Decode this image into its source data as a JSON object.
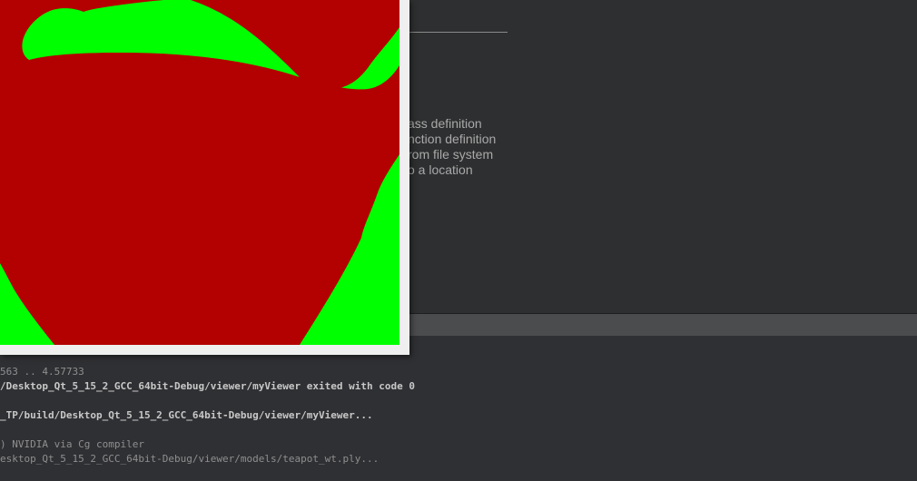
{
  "welcome": {
    "hints": [
      "ass definition",
      "nction definition",
      "rom file system",
      "o a location"
    ]
  },
  "output": {
    "lines": [
      "563 .. 4.57733",
      "/Desktop_Qt_5_15_2_GCC_64bit-Debug/viewer/myViewer exited with code 0",
      "",
      "_TP/build/Desktop_Qt_5_15_2_GCC_64bit-Debug/viewer/myViewer...",
      "",
      ") NVIDIA via Cg compiler",
      "esktop_Qt_5_15_2_GCC_64bit-Debug/viewer/models/teapot_wt.ply..."
    ]
  },
  "viewer": {
    "background_color": "#00ff00",
    "model_color": "#b30000",
    "frame_color": "#efefef"
  }
}
